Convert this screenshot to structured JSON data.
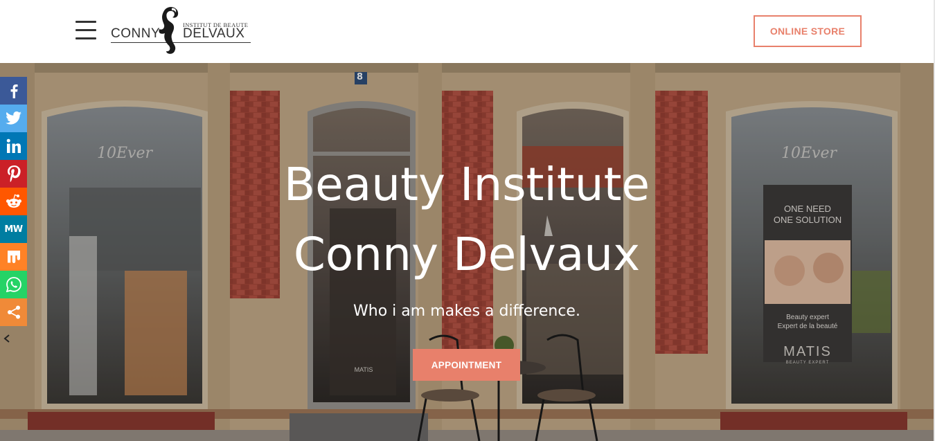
{
  "header": {
    "logo": {
      "small_text": "INSTITUT DE BEAUTE",
      "left_text": "CONNY",
      "right_text": "DELVAUX"
    },
    "online_store_label": "ONLINE STORE"
  },
  "hero": {
    "title_line1": "Beauty Institute",
    "title_line2": "Conny Delvaux",
    "subtitle": "Who i am makes a difference.",
    "appointment_label": "APPOINTMENT",
    "house_number": "8",
    "window_texts": {
      "brand_left": "10Ever",
      "brand_right": "10Ever",
      "banner_line1": "ONE NEED",
      "banner_line2": "ONE SOLUTION",
      "banner_line3": "Beauty expert",
      "banner_line4": "Expert de la beauté",
      "banner_brand": "MATIS",
      "banner_brand_sub": "BEAUTY EXPERT",
      "door_brand": "MATIS"
    }
  },
  "social": {
    "items": [
      {
        "name": "facebook",
        "color": "#3b5998",
        "icon": "facebook-icon"
      },
      {
        "name": "twitter",
        "color": "#55acee",
        "icon": "twitter-icon"
      },
      {
        "name": "linkedin",
        "color": "#0077b5",
        "icon": "linkedin-icon"
      },
      {
        "name": "pinterest",
        "color": "#cb2027",
        "icon": "pinterest-icon"
      },
      {
        "name": "reddit",
        "color": "#ff5700",
        "icon": "reddit-icon"
      },
      {
        "name": "mewe",
        "color": "#007da1",
        "icon": "mewe-icon",
        "text": "MW"
      },
      {
        "name": "mix",
        "color": "#ff8226",
        "icon": "mix-icon"
      },
      {
        "name": "whatsapp",
        "color": "#25d366",
        "icon": "whatsapp-icon"
      },
      {
        "name": "share",
        "color": "#f08a38",
        "icon": "share-icon"
      }
    ]
  },
  "colors": {
    "accent": "#e8806b",
    "text_dark": "#333333",
    "white": "#ffffff"
  }
}
